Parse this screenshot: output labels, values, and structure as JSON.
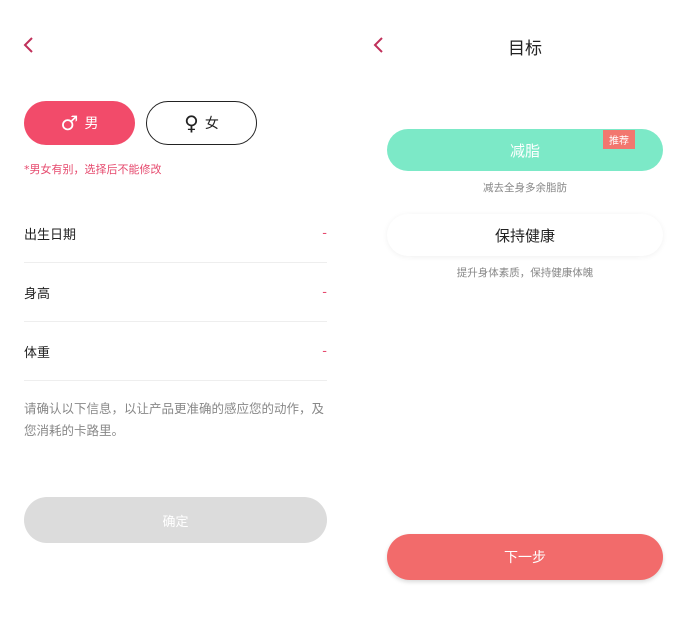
{
  "colors": {
    "accent": "#f24b6a",
    "mint": "#7ce9c7",
    "next": "#f26b6b",
    "disabled": "#dcdcdc"
  },
  "left": {
    "gender": {
      "male_symbol": "♂",
      "male_label": "男",
      "female_symbol": "♀",
      "female_label": "女",
      "selected": "male"
    },
    "gender_note": "*男女有别，选择后不能修改",
    "fields": [
      {
        "label": "出生日期",
        "value": "-"
      },
      {
        "label": "身高",
        "value": "-"
      },
      {
        "label": "体重",
        "value": "-"
      }
    ],
    "info_text": "请确认以下信息，以让产品更准确的感应您的动作，及您消耗的卡路里。",
    "confirm_label": "确定"
  },
  "right": {
    "title": "目标",
    "goals": [
      {
        "label": "减脂",
        "badge": "推荐",
        "desc": "减去全身多余脂肪"
      },
      {
        "label": "保持健康",
        "desc": "提升身体素质，保持健康体魄"
      }
    ],
    "next_label": "下一步"
  }
}
